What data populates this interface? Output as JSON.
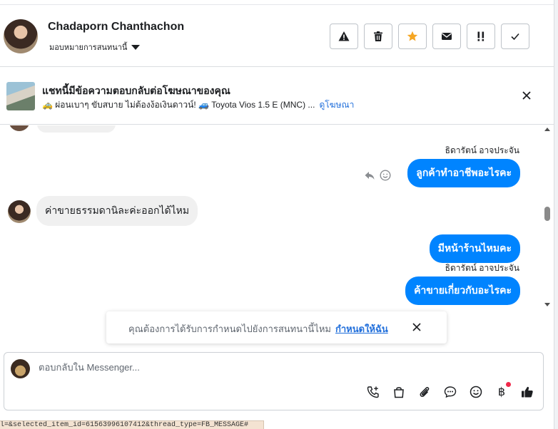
{
  "contact": {
    "name": "Chadaporn Chanthachon",
    "assign_label": "มอบหมายการสนทนานี้"
  },
  "header_actions": [
    {
      "icon": "warning-icon",
      "name": "mark-spam-button"
    },
    {
      "icon": "trash-icon",
      "name": "delete-button"
    },
    {
      "icon": "star-icon",
      "name": "follow-up-button",
      "color": "#f5a623"
    },
    {
      "icon": "envelope-icon",
      "name": "mark-unread-button"
    },
    {
      "icon": "priority-icon",
      "name": "priority-button"
    },
    {
      "icon": "check-icon",
      "name": "mark-done-button"
    }
  ],
  "ad": {
    "title": "แชทนี้มีข้อความตอบกลับต่อโฆษณาของคุณ",
    "subtitle": "🚕 ผ่อนเบาๆ ขับสบาย ไม่ต้องง้อเงินดาวน์! 🚙 Toyota Vios 1.5 E (MNC) ...",
    "link": "ดูโฆษณา"
  },
  "messages": {
    "sender_1": "ธิดารัตน์ อาจประจัน",
    "out_1": "ลูกค้าทำอาชีพอะไรคะ",
    "in_1": "ค่าขายธรรมดานิละค่ะออกได้ไหม",
    "out_2": "มีหน้าร้านไหมคะ",
    "sender_2": "ธิดารัตน์ อาจประจัน",
    "out_3": "ค้าขายเกี่ยวกับอะไรคะ"
  },
  "toast": {
    "text": "คุณต้องการได้รับการกำหนดไปยังการสนทนานี้ไหม",
    "link": "กำหนดให้ฉัน"
  },
  "composer": {
    "placeholder": "ตอบกลับใน Messenger...",
    "baht_symbol": "฿"
  },
  "status_url": "l=&selected_item_id=61563996107412&thread_type=FB_MESSAGE#",
  "colors": {
    "accent_blue": "#0084ff",
    "link_blue": "#216fdb",
    "notification_red": "#f02849"
  }
}
